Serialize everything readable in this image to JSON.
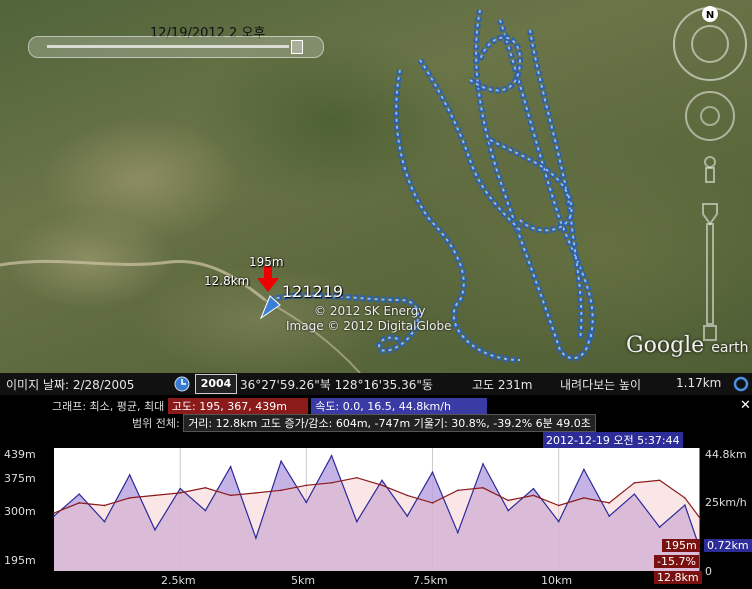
{
  "map": {
    "date_label": "12/19/2012   2 오후",
    "placemark_title": "121219",
    "elevation_tag": "195m",
    "distance_tag": "12.8km",
    "copyright_line1": "© 2012 SK Energy",
    "copyright_line2": "Image © 2012 DigitalGlobe",
    "logo_word": "Google",
    "logo_suffix": "earth",
    "compass_letter": "N"
  },
  "statusbar": {
    "imagery_date": "이미지 날짜: 2/28/2005",
    "historical_year": "2004",
    "coordinates": "36°27'59.26\"북 128°16'35.36\"동",
    "elevation": "고도   231m",
    "eye_alt_label": "내려다보는 높이",
    "eye_alt_value": "1.17km"
  },
  "profile": {
    "graph_prefix": "그래프: 최소, 평균, 최대",
    "alt_legend": "고도: 195, 367, 439m",
    "speed_legend": "속도: 0.0, 16.5, 44.8km/h",
    "range_prefix": "범위 전체:",
    "distance_stat": "거리: 12.8km",
    "gain_loss_stat": "고도 증가/감소: 604m, -747m",
    "slope_stat": "기울기: 30.8%, -39.2%",
    "time_stat": "6분 49.0초",
    "cursor_time": "2012-12-19 오전 5:37:44",
    "y_left": [
      "439m",
      "375m",
      "300m",
      "195m"
    ],
    "y_right": [
      "44.8km",
      "25km/h",
      "0"
    ],
    "x_ticks": [
      "2.5km",
      "5km",
      "7.5km",
      "10km"
    ],
    "cursor_alt": "195m",
    "cursor_speed": "0.72km",
    "cursor_slope": "-15.7%",
    "cursor_dist": "12.8km",
    "colors": {
      "altitude": "#8b1a1a",
      "speed": "#2a2a9a",
      "alt_fill": "#f5c8c8",
      "speed_fill": "#b8a0e0"
    }
  },
  "chart_data": {
    "type": "line",
    "xlabel": "",
    "ylabel": "",
    "x_ticks": [
      2.5,
      5,
      7.5,
      10
    ],
    "xlim": [
      0,
      12.8
    ],
    "ylim": [
      195,
      439
    ],
    "y2lim": [
      0,
      44.8
    ],
    "series": [
      {
        "name": "고도",
        "unit": "m",
        "axis": "left",
        "x": [
          0,
          0.5,
          1,
          1.5,
          2,
          2.5,
          3,
          3.5,
          4,
          4.5,
          5,
          5.5,
          6,
          6.5,
          7,
          7.5,
          8,
          8.5,
          9,
          9.5,
          10,
          10.5,
          11,
          11.5,
          12,
          12.5,
          12.8
        ],
        "values": [
          310,
          330,
          325,
          340,
          345,
          350,
          360,
          345,
          350,
          355,
          365,
          370,
          380,
          365,
          345,
          330,
          355,
          360,
          335,
          345,
          325,
          340,
          330,
          370,
          375,
          340,
          300
        ]
      },
      {
        "name": "속도",
        "unit": "km/h",
        "axis": "right",
        "x": [
          0,
          0.5,
          1,
          1.5,
          2,
          2.5,
          3,
          3.5,
          4,
          4.5,
          5,
          5.5,
          6,
          6.5,
          7,
          7.5,
          8,
          8.5,
          9,
          9.5,
          10,
          10.5,
          11,
          11.5,
          12,
          12.5,
          12.8
        ],
        "values": [
          20,
          28,
          18,
          35,
          15,
          30,
          22,
          38,
          12,
          40,
          25,
          42,
          18,
          33,
          20,
          36,
          14,
          39,
          22,
          30,
          18,
          37,
          20,
          28,
          16,
          24,
          8
        ]
      }
    ]
  }
}
